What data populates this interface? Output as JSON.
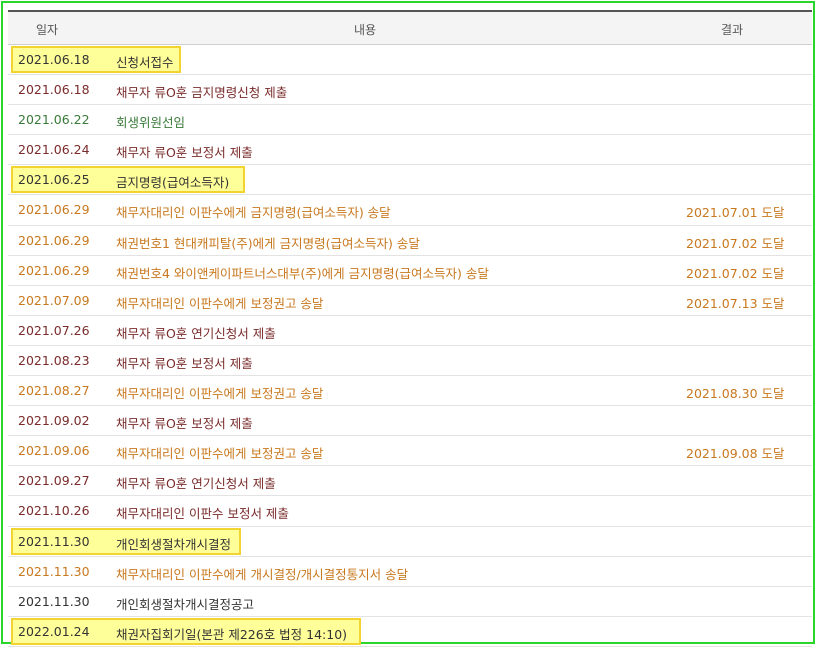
{
  "header": {
    "date": "일자",
    "content": "내용",
    "result": "결과"
  },
  "colors": {
    "black": "#333333",
    "red": "#7a2b2b",
    "green": "#3a7a3a",
    "orange": "#c8781e",
    "highlight": "#ffff99"
  },
  "rows": [
    {
      "date": "2021.06.18",
      "content": "신청서접수",
      "result": "",
      "color": "black",
      "highlight": true
    },
    {
      "date": "2021.06.18",
      "content": "채무자 류O훈 금지명령신청 제출",
      "result": "",
      "color": "red",
      "highlight": false
    },
    {
      "date": "2021.06.22",
      "content": "회생위원선임",
      "result": "",
      "color": "green",
      "highlight": false
    },
    {
      "date": "2021.06.24",
      "content": "채무자 류O훈 보정서 제출",
      "result": "",
      "color": "red",
      "highlight": false
    },
    {
      "date": "2021.06.25",
      "content": "금지명령(급여소득자)",
      "result": "",
      "color": "black",
      "highlight": true
    },
    {
      "date": "2021.06.29",
      "content": "채무자대리인 이판수에게 금지명령(급여소득자) 송달",
      "result": "2021.07.01 도달",
      "color": "orange",
      "highlight": false
    },
    {
      "date": "2021.06.29",
      "content": "채권번호1 현대캐피탈(주)에게 금지명령(급여소득자) 송달",
      "result": "2021.07.02 도달",
      "color": "orange",
      "highlight": false
    },
    {
      "date": "2021.06.29",
      "content": "채권번호4 와이앤케이파트너스대부(주)에게 금지명령(급여소득자) 송달",
      "result": "2021.07.02 도달",
      "color": "orange",
      "highlight": false
    },
    {
      "date": "2021.07.09",
      "content": "채무자대리인 이판수에게 보정권고 송달",
      "result": "2021.07.13 도달",
      "color": "orange",
      "highlight": false
    },
    {
      "date": "2021.07.26",
      "content": "채무자 류O훈 연기신청서 제출",
      "result": "",
      "color": "red",
      "highlight": false
    },
    {
      "date": "2021.08.23",
      "content": "채무자 류O훈 보정서 제출",
      "result": "",
      "color": "red",
      "highlight": false
    },
    {
      "date": "2021.08.27",
      "content": "채무자대리인 이판수에게 보정권고 송달",
      "result": "2021.08.30 도달",
      "color": "orange",
      "highlight": false
    },
    {
      "date": "2021.09.02",
      "content": "채무자 류O훈 보정서 제출",
      "result": "",
      "color": "red",
      "highlight": false
    },
    {
      "date": "2021.09.06",
      "content": "채무자대리인 이판수에게 보정권고 송달",
      "result": "2021.09.08 도달",
      "color": "orange",
      "highlight": false
    },
    {
      "date": "2021.09.27",
      "content": "채무자 류O훈 연기신청서 제출",
      "result": "",
      "color": "red",
      "highlight": false
    },
    {
      "date": "2021.10.26",
      "content": "채무자대리인 이판수 보정서 제출",
      "result": "",
      "color": "red",
      "highlight": false
    },
    {
      "date": "2021.11.30",
      "content": "개인회생절차개시결정",
      "result": "",
      "color": "black",
      "highlight": true
    },
    {
      "date": "2021.11.30",
      "content": "채무자대리인 이판수에게 개시결정/개시결정통지서 송달",
      "result": "",
      "color": "orange",
      "highlight": false
    },
    {
      "date": "2021.11.30",
      "content": "개인회생절차개시결정공고",
      "result": "",
      "color": "black",
      "highlight": false
    },
    {
      "date": "2022.01.24",
      "content": "채권자집회기일(본관 제226호 법정 14:10)",
      "result": "",
      "color": "black",
      "highlight": true
    }
  ]
}
